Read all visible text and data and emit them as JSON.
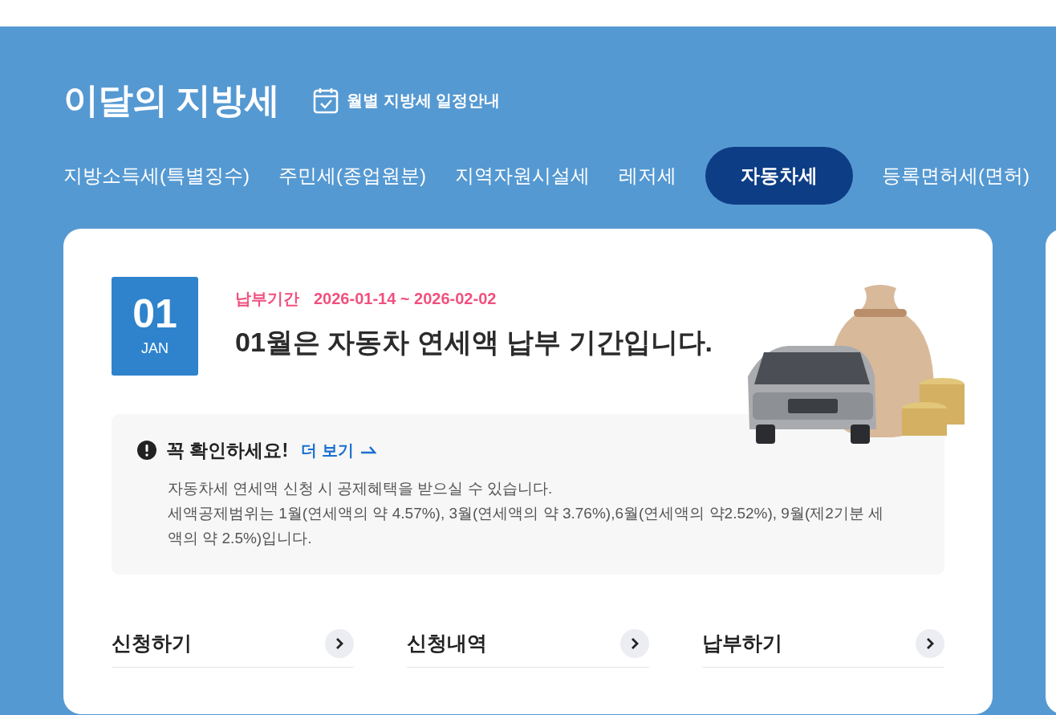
{
  "header": {
    "title": "이달의 지방세",
    "schedule_link": "월별 지방세 일정안내"
  },
  "tabs": [
    {
      "label": "지방소득세(특별징수)",
      "selected": false
    },
    {
      "label": "주민세(종업원분)",
      "selected": false
    },
    {
      "label": "지역자원시설세",
      "selected": false
    },
    {
      "label": "레저세",
      "selected": false
    },
    {
      "label": "자동차세",
      "selected": true
    },
    {
      "label": "등록면허세(면허)",
      "selected": false
    }
  ],
  "card": {
    "date_badge": {
      "day": "01",
      "month": "JAN"
    },
    "period_label": "납부기간",
    "period": "2026-01-14 ~ 2026-02-02",
    "headline": "01월은 자동차 연세액 납부 기간입니다.",
    "notice": {
      "title": "꼭 확인하세요!",
      "more_link": "더 보기",
      "lines": [
        "자동차세 연세액 신청 시 공제혜택을 받으실 수 있습니다.",
        "세액공제범위는 1월(연세액의 약 4.57%), 3월(연세액의 약 3.76%),6월(연세액의 약2.52%), 9월(제2기분 세액의 약 2.5%)입니다."
      ]
    },
    "links": [
      "신청하기",
      "신청내역",
      "납부하기"
    ]
  }
}
